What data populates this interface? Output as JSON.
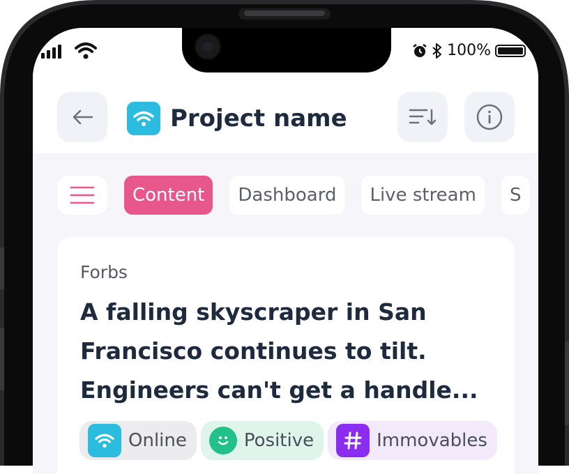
{
  "status": {
    "battery": "100%"
  },
  "header": {
    "title": "Project name",
    "title_icon": "wifi-icon",
    "accent": "#2bbce0"
  },
  "tabs": [
    {
      "label": "Content",
      "active": true
    },
    {
      "label": "Dashboard",
      "active": false
    },
    {
      "label": "Live stream",
      "active": false
    },
    {
      "label": "S",
      "active": false
    }
  ],
  "tab_accent": "#e8578a",
  "card": {
    "source": "Forbs",
    "headline": "A falling skyscraper in San Francisco continues to tilt. Engineers can't get a handle...",
    "tags": [
      {
        "label": "Online",
        "icon": "wifi-icon",
        "bg": "#ececef",
        "icon_bg": "#2bbce0"
      },
      {
        "label": "Positive",
        "icon": "smile-icon",
        "bg": "#dff5ec",
        "icon_bg": "#22c08a"
      },
      {
        "label": "Immovables",
        "icon": "hash-icon",
        "bg": "#f2e9fb",
        "icon_bg": "#8b2df0"
      }
    ]
  }
}
